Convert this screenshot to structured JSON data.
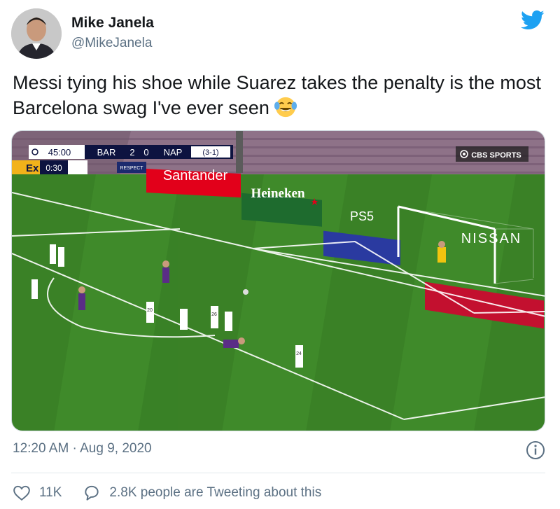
{
  "author": {
    "name": "Mike Janela",
    "handle": "@MikeJanela"
  },
  "tweet": {
    "text": "Messi tying his shoe while Suarez takes the penalty is the most Barcelona swag I've ever seen",
    "emoji": "face-with-tears-of-joy"
  },
  "media": {
    "scoreboard": {
      "clock": "45:00",
      "home_team": "BAR",
      "home_score": "2",
      "away_score": "0",
      "away_team": "NAP",
      "aggregate": "(3-1)",
      "extra_time_label": "Ex",
      "extra_time_clock": "0:30"
    },
    "broadcaster": "CBS SPORTS",
    "boards": {
      "respect": "RESPECT",
      "santander": "Santander",
      "heineken": "Heineken",
      "ps5": "PS5",
      "nissan": "NISSAN"
    },
    "shirt_numbers": [
      "20",
      "26",
      "24"
    ]
  },
  "meta": {
    "timestamp": "12:20 AM · Aug 9, 2020"
  },
  "engagement": {
    "likes": "11K",
    "tweeting": "2.8K people are Tweeting about this"
  },
  "colors": {
    "text": "#14171a",
    "secondary": "#5b7083",
    "twitter_blue": "#1da1f2",
    "pitch": "#3f8a2a"
  }
}
